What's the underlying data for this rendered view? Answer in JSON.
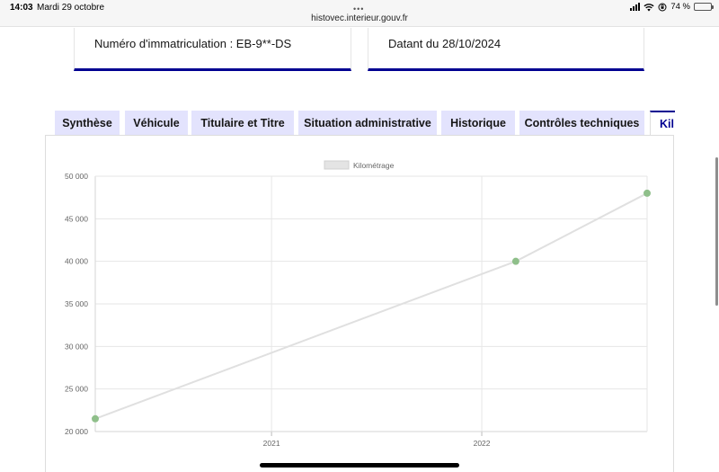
{
  "status_bar": {
    "time": "14:03",
    "date": "Mardi 29 octobre",
    "url": "histovec.interieur.gouv.fr",
    "battery_percent": 74,
    "battery_label": "74 %"
  },
  "cards": {
    "registration": "Numéro d'immatriculation : EB-9**-DS",
    "dated": "Datant du 28/10/2024"
  },
  "tabs": [
    {
      "label": "Synthèse"
    },
    {
      "label": "Véhicule"
    },
    {
      "label": "Titulaire et Titre"
    },
    {
      "label": "Situation administrative"
    },
    {
      "label": "Historique"
    },
    {
      "label": "Contrôles techniques"
    },
    {
      "label": "Kil"
    }
  ],
  "colors": {
    "accent": "#000091",
    "tab_bg": "#e3e3fd",
    "line": "#e0e0e0",
    "point": "#8fbf8a"
  },
  "chart_data": {
    "type": "line",
    "series": [
      {
        "name": "Kilométrage",
        "points": [
          {
            "x": "2020-03-01",
            "y": 21500
          },
          {
            "x": "2022-03-01",
            "y": 40000
          },
          {
            "x": "2022-10-15",
            "y": 48000
          }
        ]
      }
    ],
    "x_ticks": [
      "2021",
      "2022"
    ],
    "y_ticks": [
      "20 000",
      "25 000",
      "30 000",
      "35 000",
      "40 000",
      "45 000",
      "50 000"
    ],
    "ylim": [
      20000,
      50000
    ],
    "grid": true,
    "legend": "top-center"
  }
}
